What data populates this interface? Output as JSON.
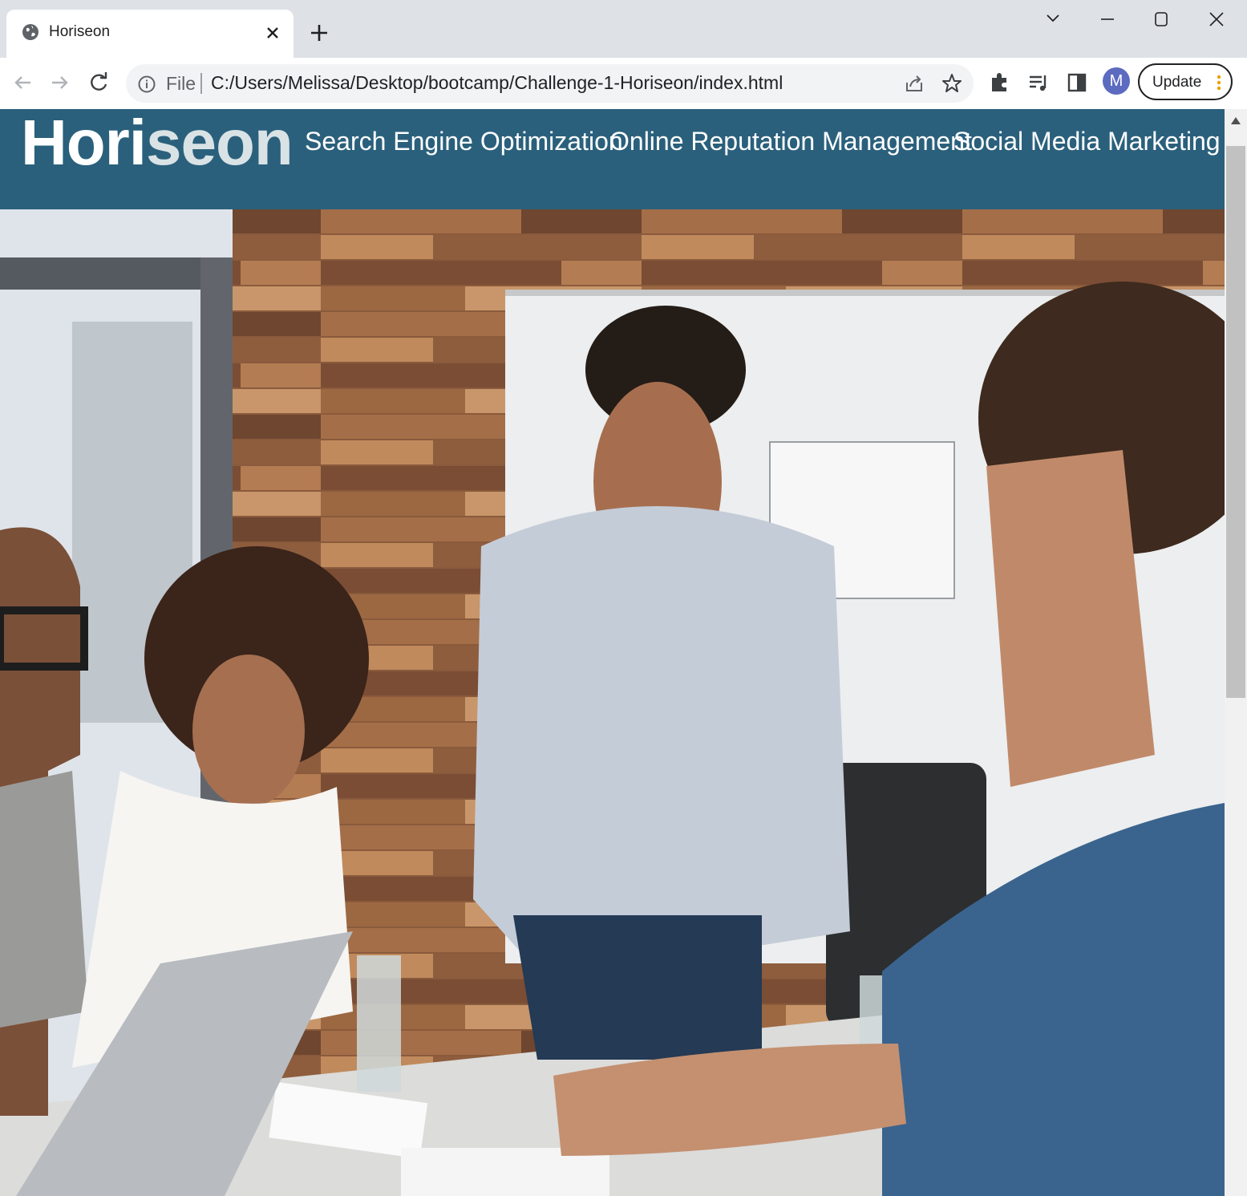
{
  "browser": {
    "tab_title": "Horiseon",
    "url_scheme": "File",
    "url": "C:/Users/Melissa/Desktop/bootcamp/Challenge-1-Horiseon/index.html",
    "profile_initial": "M",
    "update_label": "Update"
  },
  "site": {
    "logo_main": "Hori",
    "logo_accent": "seon",
    "nav": [
      {
        "label": "Search Engine Optimization"
      },
      {
        "label": "Online Reputation Management"
      },
      {
        "label": "Social Media Marketing"
      }
    ]
  },
  "colors": {
    "header_bg": "#2a607c",
    "logo_accent": "#d9e2e5",
    "tabstrip_bg": "#dee1e6",
    "avatar_bg": "#5c6bc0"
  }
}
